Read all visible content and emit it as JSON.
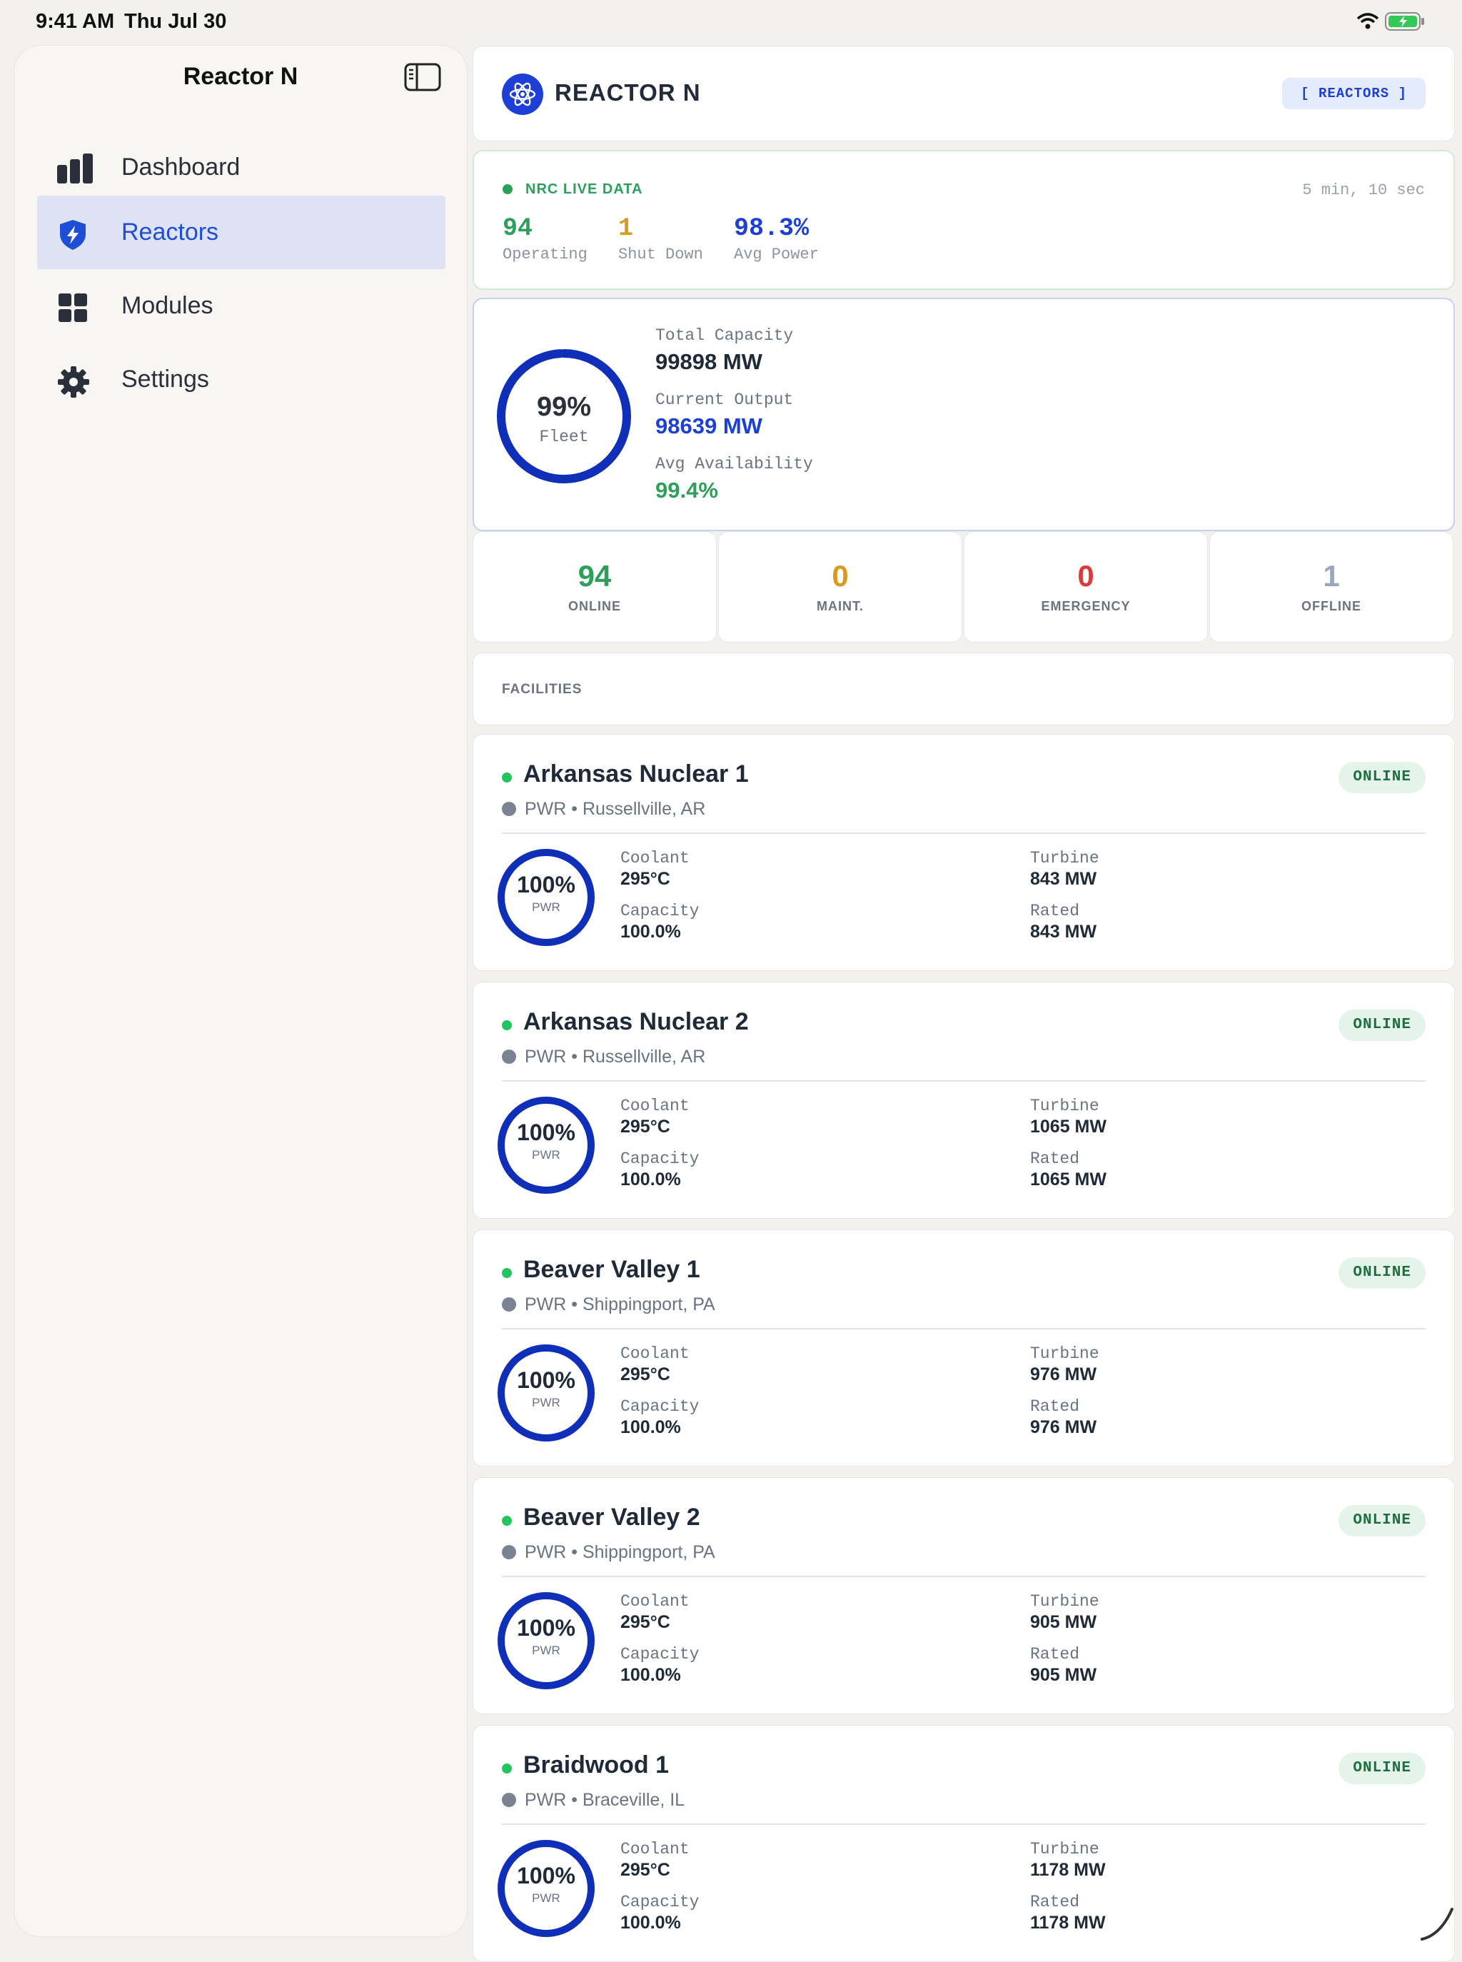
{
  "status_bar": {
    "time": "9:41 AM",
    "date": "Thu Jul 30"
  },
  "sidebar": {
    "title": "Reactor N",
    "items": [
      {
        "label": "Dashboard",
        "icon": "bar-chart-icon"
      },
      {
        "label": "Reactors",
        "icon": "shield-bolt-icon"
      },
      {
        "label": "Modules",
        "icon": "grid-icon"
      },
      {
        "label": "Settings",
        "icon": "gear-icon"
      }
    ]
  },
  "header": {
    "title": "REACTOR N",
    "badge": "[ REACTORS ]"
  },
  "live": {
    "label": "NRC LIVE DATA",
    "updated": "5 min, 10 sec",
    "stats": [
      {
        "value": "94",
        "caption": "Operating",
        "color": "#2e9e5b"
      },
      {
        "value": "1",
        "caption": "Shut Down",
        "color": "#d99a1e"
      },
      {
        "value": "98.3%",
        "caption": "Avg Power",
        "color": "#1d3fd6"
      }
    ]
  },
  "fleet": {
    "percent": "99%",
    "percent_value": 0.99,
    "label": "Fleet",
    "total_capacity_label": "Total Capacity",
    "total_capacity": "99898 MW",
    "current_output_label": "Current Output",
    "current_output": "98639 MW",
    "avg_availability_label": "Avg Availability",
    "avg_availability": "99.4%"
  },
  "status_tiles": [
    {
      "value": "94",
      "label": "ONLINE",
      "color": "#2e9e5b"
    },
    {
      "value": "0",
      "label": "MAINT.",
      "color": "#d99a1e"
    },
    {
      "value": "0",
      "label": "EMERGENCY",
      "color": "#dc3b3b"
    },
    {
      "value": "1",
      "label": "OFFLINE",
      "color": "#9aa7bd"
    }
  ],
  "facilities_label": "FACILITIES",
  "reactors": [
    {
      "name": "Arkansas Nuclear 1",
      "sub": "PWR • Russellville, AR",
      "status": "ONLINE",
      "percent": "100%",
      "type": "PWR",
      "coolant_label": "Coolant",
      "coolant": "295°C",
      "capacity_label": "Capacity",
      "capacity": "100.0%",
      "turbine_label": "Turbine",
      "turbine": "843 MW",
      "rated_label": "Rated",
      "rated": "843 MW"
    },
    {
      "name": "Arkansas Nuclear 2",
      "sub": "PWR • Russellville, AR",
      "status": "ONLINE",
      "percent": "100%",
      "type": "PWR",
      "coolant_label": "Coolant",
      "coolant": "295°C",
      "capacity_label": "Capacity",
      "capacity": "100.0%",
      "turbine_label": "Turbine",
      "turbine": "1065 MW",
      "rated_label": "Rated",
      "rated": "1065 MW"
    },
    {
      "name": "Beaver Valley 1",
      "sub": "PWR • Shippingport, PA",
      "status": "ONLINE",
      "percent": "100%",
      "type": "PWR",
      "coolant_label": "Coolant",
      "coolant": "295°C",
      "capacity_label": "Capacity",
      "capacity": "100.0%",
      "turbine_label": "Turbine",
      "turbine": "976 MW",
      "rated_label": "Rated",
      "rated": "976 MW"
    },
    {
      "name": "Beaver Valley 2",
      "sub": "PWR • Shippingport, PA",
      "status": "ONLINE",
      "percent": "100%",
      "type": "PWR",
      "coolant_label": "Coolant",
      "coolant": "295°C",
      "capacity_label": "Capacity",
      "capacity": "100.0%",
      "turbine_label": "Turbine",
      "turbine": "905 MW",
      "rated_label": "Rated",
      "rated": "905 MW"
    },
    {
      "name": "Braidwood 1",
      "sub": "PWR • Braceville, IL",
      "status": "ONLINE",
      "percent": "100%",
      "type": "PWR",
      "coolant_label": "Coolant",
      "coolant": "295°C",
      "capacity_label": "Capacity",
      "capacity": "100.0%",
      "turbine_label": "Turbine",
      "turbine": "1178 MW",
      "rated_label": "Rated",
      "rated": "1178 MW"
    }
  ]
}
